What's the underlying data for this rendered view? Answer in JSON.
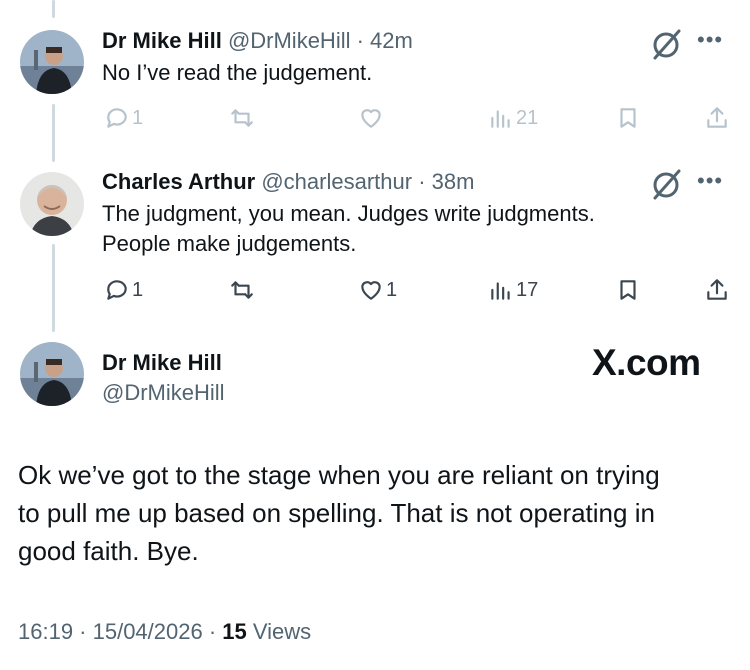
{
  "replies": [
    {
      "name": "Dr Mike Hill",
      "handle": "@DrMikeHill",
      "time": "· 42m",
      "lines": [
        "No I’ve read the judgement."
      ],
      "actions": {
        "replies": "1",
        "reposts": "",
        "likes": "",
        "views": "21"
      }
    },
    {
      "name": "Charles Arthur",
      "handle": "@charlesarthur",
      "time": "· 38m",
      "lines": [
        "The judgment, you mean. Judges write judgments.",
        "People make judgements."
      ],
      "actions": {
        "replies": "1",
        "reposts": "",
        "likes": "1",
        "views": "17"
      }
    }
  ],
  "main": {
    "name": "Dr Mike Hill",
    "handle": "@DrMikeHill",
    "watermark": "X.com",
    "lines": [
      "Ok we’ve got to the stage when you are reliant on trying",
      "to pull me up based on spelling. That is not operating in",
      "good faith. Bye."
    ],
    "timestamp": "16:19 · 15/04/2026 · ",
    "view_count": "15",
    "views_label": "Views"
  },
  "icons": {
    "reply": "reply-icon",
    "repost": "repost-icon",
    "like": "like-icon",
    "views": "views-icon",
    "bookmark": "bookmark-icon",
    "share": "share-icon",
    "grok": "grok-icon",
    "more": "more-icon"
  },
  "colors": {
    "text": "#0f1419",
    "muted": "#536471",
    "thread_line": "#cfd9de",
    "faded_action": "#b6c3cc"
  }
}
